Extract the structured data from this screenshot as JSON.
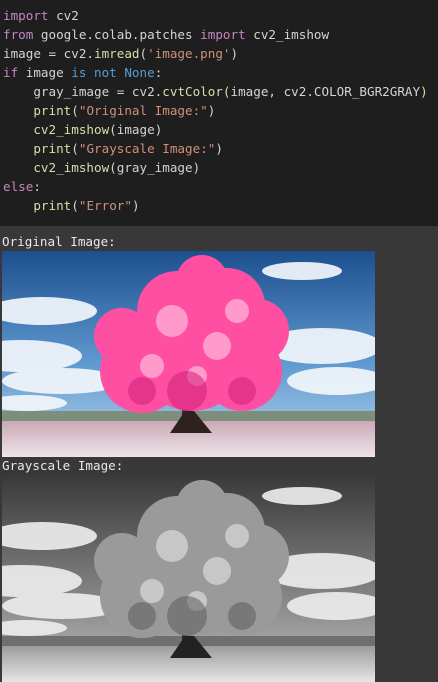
{
  "code": {
    "line1": {
      "kw": "import",
      "rest": " cv2"
    },
    "line2": {
      "kw1": "from",
      "mod": " google.colab.patches ",
      "kw2": "import",
      "rest": " cv2_imshow"
    },
    "line3": {
      "lhs": "image = cv2.",
      "fn": "imread",
      "open": "(",
      "arg": "'image.png'",
      "close": ")"
    },
    "line4": {
      "kw1": "if",
      "mid": " image ",
      "kw2": "is not",
      "sp": " ",
      "const": "None",
      "colon": ":"
    },
    "line5": {
      "indent": "    ",
      "lhs": "gray_image = cv2.",
      "fn": "cvtColor",
      "open": "(",
      "args": "image, cv2.COLOR_BGR2GRAY",
      "close": ")"
    },
    "line6": {
      "indent": "    ",
      "fn": "print",
      "open": "(",
      "arg": "\"Original Image:\"",
      "close": ")"
    },
    "line7": {
      "indent": "    ",
      "fn": "cv2_imshow",
      "open": "(",
      "arg": "image",
      "close": ")"
    },
    "line8": {
      "indent": "    ",
      "fn": "print",
      "open": "(",
      "arg": "\"Grayscale Image:\"",
      "close": ")"
    },
    "line9": {
      "indent": "    ",
      "fn": "cv2_imshow",
      "open": "(",
      "arg": "gray_image",
      "close": ")"
    },
    "line10": {
      "kw": "else",
      "colon": ":"
    },
    "line11": {
      "indent": "    ",
      "fn": "print",
      "open": "(",
      "arg": "\"Error\"",
      "close": ")"
    }
  },
  "output": {
    "original_label": "Original Image:",
    "grayscale_label": "Grayscale Image:"
  },
  "colors": {
    "code_bg": "#1e1e1e",
    "output_bg": "#383838",
    "keyword_blue": "#569cd6",
    "keyword_purple": "#c586c0",
    "function": "#dcdcaa",
    "string": "#ce9178"
  }
}
